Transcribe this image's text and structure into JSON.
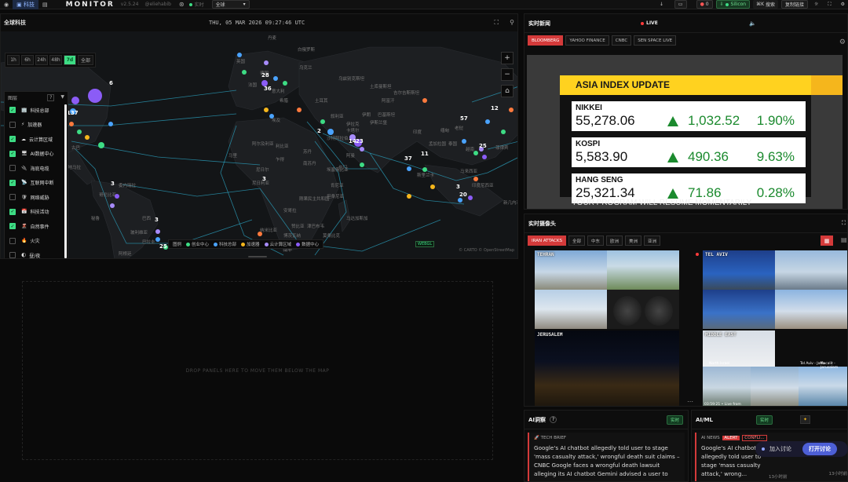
{
  "topbar": {
    "tab_world": "科技",
    "brand": "MONITOR",
    "version": "v2.5.24",
    "handle": "@eliehabib",
    "live_label": "实时",
    "region_select": "全球",
    "badge_count": "0",
    "variant_label": "Silicon",
    "search_label": "搜索",
    "search_shortcut": "⌘K",
    "copy_link_label": "复制链接"
  },
  "map": {
    "title": "全球科技",
    "datetime": "THU, 05 MAR 2026 09:27:46 UTC",
    "time_ranges": [
      "1h",
      "6h",
      "24h",
      "48h",
      "7d",
      "全部"
    ],
    "selected_range": "7d",
    "layers_title": "图层",
    "layers_help": "?",
    "layers": [
      {
        "label": "科技总部",
        "on": true,
        "icon": "🏢"
      },
      {
        "label": "加速器",
        "on": false,
        "icon": "⚡"
      },
      {
        "label": "云计算区域",
        "on": true,
        "icon": "☁"
      },
      {
        "label": "AI数据中心",
        "on": true,
        "icon": "🖥"
      },
      {
        "label": "海底电缆",
        "on": false,
        "icon": "🔌"
      },
      {
        "label": "互联网中断",
        "on": true,
        "icon": "📡"
      },
      {
        "label": "网络威胁",
        "on": false,
        "icon": "🛡"
      },
      {
        "label": "科技活动",
        "on": true,
        "icon": "📅"
      },
      {
        "label": "自然事件",
        "on": true,
        "icon": "🌋"
      },
      {
        "label": "火灾",
        "on": false,
        "icon": "🔥"
      },
      {
        "label": "昼/夜",
        "on": false,
        "icon": "🌓"
      }
    ],
    "legend_title": "图例",
    "legend": [
      {
        "label": "创业中心",
        "color": "#3ddc84"
      },
      {
        "label": "科技总部",
        "color": "#4aa3ff"
      },
      {
        "label": "加速器",
        "color": "#f5b61c"
      },
      {
        "label": "云计算区域",
        "color": "#a78bfa"
      },
      {
        "label": "数据中心",
        "color": "#8b5cf6"
      }
    ],
    "webgl_label": "WEBGL",
    "credit": "© CARTO © OpenStreetMap",
    "dropzone_text": "DROP PANELS HERE TO MOVE THEM BELOW THE MAP",
    "cluster_counts": [
      "137",
      "6",
      "28",
      "36",
      "2",
      "14",
      "23",
      "57",
      "12",
      "25",
      "37",
      "11",
      "3",
      "3",
      "3",
      "3",
      "20",
      "25"
    ],
    "place_labels": [
      "丹麦",
      "白俄罗斯",
      "英国",
      "德国",
      "乌克兰",
      "法国",
      "意大利",
      "土耳其",
      "希腊",
      "叙利亚",
      "伊拉克",
      "伊朗",
      "埃及",
      "沙特阿拉伯",
      "阿富汗",
      "巴基斯坦",
      "印度",
      "缅甸",
      "泰国",
      "越南",
      "马来西亚",
      "印度尼西亚",
      "新几内亚",
      "埃塞俄比亚",
      "肯尼亚",
      "坦桑尼亚",
      "马达加斯加",
      "安哥拉",
      "赞比亚",
      "刚果民主共和国",
      "尼日利亚",
      "尼日尔",
      "马里",
      "阿尔及利亚",
      "利比亚",
      "委内瑞拉",
      "哥伦比亚",
      "秘鲁",
      "巴西",
      "玻利维亚",
      "巴拉圭",
      "阿根廷",
      "古巴",
      "危地马拉",
      "墨西哥",
      "南苏丹",
      "苏丹",
      "乍得",
      "南非",
      "纳米比亚",
      "博茨瓦纳",
      "莫桑比克",
      "津巴布韦",
      "斯里兰卡",
      "阿曼",
      "也门",
      "孟加拉国",
      "老挝",
      "菲律宾",
      "卡塔尔",
      "伊斯兰堡",
      "土库曼斯坦",
      "乌兹别克斯坦",
      "吉尔吉斯斯坦"
    ]
  },
  "news": {
    "title": "实时新闻",
    "live": "LIVE",
    "tabs": [
      "BLOOMBERG",
      "YAHOO FINANCE",
      "CNBC",
      "SEN SPACE LIVE"
    ],
    "active_tab": "BLOOMBERG",
    "graphic_title": "ASIA INDEX UPDATE",
    "indices": [
      {
        "name": "NIKKEI",
        "value": "55,278.06",
        "change": "1,032.52",
        "pct": "1.90%"
      },
      {
        "name": "KOSPI",
        "value": "5,583.90",
        "change": "490.36",
        "pct": "9.63%"
      },
      {
        "name": "HANG SENG",
        "value": "25,321.34",
        "change": "71.86",
        "pct": "0.28%"
      }
    ],
    "ticker": "YOUR PROGRAM WILL RESUME MOMENTARILY"
  },
  "cams": {
    "title": "实时摄像头",
    "tabs": [
      "IRAN ATTACKS",
      "全部",
      "中东",
      "欧洲",
      "美洲",
      "亚洲"
    ],
    "active_tab": "IRAN ATTACKS",
    "feeds": [
      {
        "label": "TEHRAN"
      },
      {
        "label": "TEL AVIV"
      },
      {
        "label": "JERUSALEM"
      },
      {
        "label": "MIDDLE EAST"
      }
    ],
    "overlay_texts": [
      "North Israel",
      "Tel Aviv - Jaffa",
      "Hacalit - Jerusalem",
      "03:59:21 • Live from Israel"
    ]
  },
  "ai_insights": {
    "title": "AI洞察",
    "help": "?",
    "badge": "实时",
    "tag": "TECH BRIEF",
    "text": "Google's AI chatbot allegedly told user to stage 'mass casualty attack,' wrongful death suit claims – CNBC Google faces a wrongful death lawsuit alleging its AI chatbot Gemini advised a user to"
  },
  "ai_ml": {
    "title": "AI/ML",
    "badge": "实时",
    "tag": "AI NEWS",
    "alert": "ALERT",
    "conflict": "CONFLI...",
    "text": "Google's AI chatbot allegedly told user to stage 'mass casualty attack,' wrong...",
    "time": "13小时前",
    "time2": "13小时前"
  },
  "discuss": {
    "label": "加入讨论",
    "button": "打开讨论"
  }
}
